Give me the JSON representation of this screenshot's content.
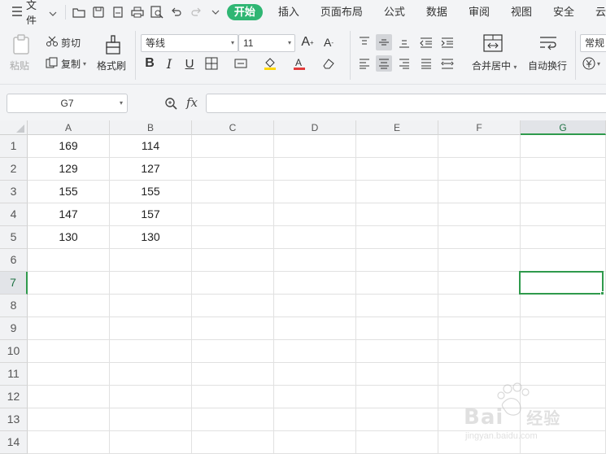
{
  "menubar": {
    "file_label": "文件",
    "tabs": [
      "开始",
      "插入",
      "页面布局",
      "公式",
      "数据",
      "审阅",
      "视图",
      "安全",
      "云"
    ]
  },
  "ribbon": {
    "paste": "粘贴",
    "cut": "剪切",
    "copy": "复制",
    "format_painter": "格式刷",
    "font_name": "等线",
    "font_size": "11",
    "merge_center": "合并居中",
    "wrap_text": "自动换行",
    "number_format": "常规"
  },
  "formula_bar": {
    "cell_ref": "G7",
    "fx": "fx",
    "formula": ""
  },
  "sheet": {
    "columns": [
      "A",
      "B",
      "C",
      "D",
      "E",
      "F",
      "G"
    ],
    "rows": [
      "1",
      "2",
      "3",
      "4",
      "5",
      "6",
      "7",
      "8",
      "9",
      "10",
      "11",
      "12",
      "13",
      "14"
    ],
    "cells": [
      [
        "169",
        "114"
      ],
      [
        "129",
        "127"
      ],
      [
        "155",
        "155"
      ],
      [
        "147",
        "157"
      ],
      [
        "130",
        "130"
      ]
    ],
    "selected_cell": "G7"
  },
  "watermark": {
    "brand": "Bai",
    "brand_cn": "经验",
    "url": "jingyan.baidu.com"
  },
  "colors": {
    "accent": "#2fb673",
    "selection": "#2f9a4c"
  }
}
